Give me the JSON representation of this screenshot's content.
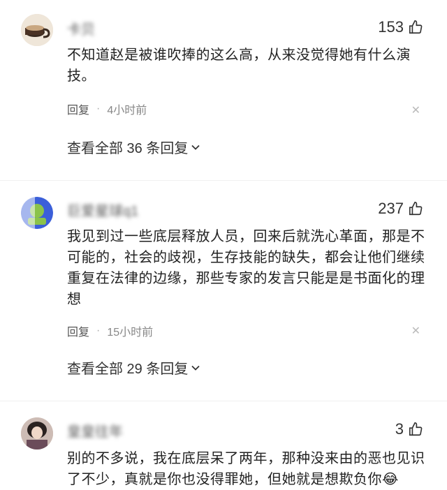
{
  "comments": [
    {
      "username": "卡贝",
      "likes": "153",
      "text": "不知道赵是被谁吹捧的这么高，从来没觉得她有什么演技。",
      "reply_label": "回复",
      "time": "4小时前",
      "view_all": "查看全部 36 条回复"
    },
    {
      "username": "巨爱星球q1",
      "likes": "237",
      "text": "我见到过一些底层释放人员，回来后就洗心革面，那是不可能的，社会的歧视，生存技能的缺失，都会让他们继续重复在法律的边缘，那些专家的发言只能是是书面化的理想",
      "reply_label": "回复",
      "time": "15小时前",
      "view_all": "查看全部 29 条回复"
    },
    {
      "username": "皇皇往年",
      "likes": "3",
      "text": "别的不多说，我在底层呆了两年，那种没来由的恶也见识了不少，真就是你也没得罪她，但她就是想欺负你😂"
    }
  ],
  "icons": {
    "like": "thumbs-up-icon",
    "chevron": "chevron-down-icon",
    "close": "close-icon"
  },
  "colors": {
    "text": "#222222",
    "meta": "#888888",
    "accent_avatar_blue": "#3b5fd9",
    "accent_avatar_green": "#8bc34a"
  }
}
